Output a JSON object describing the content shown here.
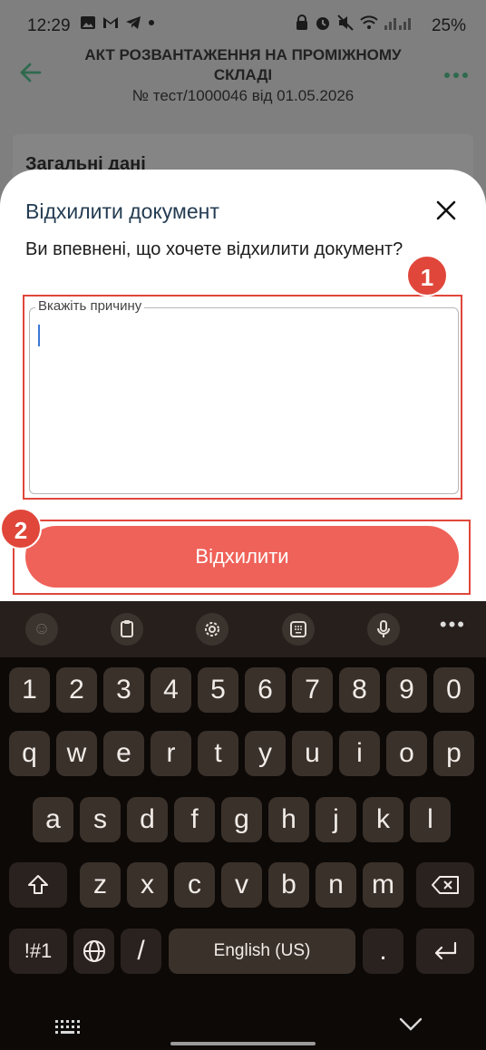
{
  "status_bar": {
    "time": "12:29",
    "battery": "25%",
    "left_icons": [
      "gallery-icon",
      "gmail-icon",
      "telegram-icon",
      "dot-icon"
    ],
    "right_icons": [
      "lock-icon",
      "alarm-icon",
      "mute-icon",
      "wifi-icon",
      "signal-icon"
    ]
  },
  "header": {
    "title_line1": "АКТ РОЗВАНТАЖЕННЯ НА ПРОМІЖНОМУ",
    "title_line2": "СКЛАДІ",
    "subtitle": "№ тест/1000046 від 01.05.2026"
  },
  "background_card": {
    "title": "Загальні дані"
  },
  "dialog": {
    "title": "Відхилити документ",
    "question": "Ви впевнені, що хочете відхилити документ?",
    "reason_label": "Вкажіть причину",
    "reason_value": "",
    "reject_button": "Відхилити",
    "callout_1": "1",
    "callout_2": "2"
  },
  "keyboard": {
    "toolbar": [
      "emoji-icon",
      "clipboard-icon",
      "settings-icon",
      "keypad-icon",
      "microphone-icon",
      "more-icon"
    ],
    "row_numbers": [
      "1",
      "2",
      "3",
      "4",
      "5",
      "6",
      "7",
      "8",
      "9",
      "0"
    ],
    "row_top": [
      "q",
      "w",
      "e",
      "r",
      "t",
      "y",
      "u",
      "i",
      "o",
      "p"
    ],
    "row_middle": [
      "a",
      "s",
      "d",
      "f",
      "g",
      "h",
      "j",
      "k",
      "l"
    ],
    "row_bottom": [
      "z",
      "x",
      "c",
      "v",
      "b",
      "n",
      "m"
    ],
    "symbols_key": "!#1",
    "slash_key": "/",
    "space_key": "English (US)",
    "period_key": ".",
    "shift_icon": "shift-icon",
    "backspace_icon": "backspace-icon",
    "globe_icon": "globe-icon",
    "enter_icon": "enter-icon"
  },
  "colors": {
    "accent_green": "#2f6a4f",
    "reject_button": "#ef6259",
    "annotation_red": "#e0473a",
    "dialog_title": "#243c52"
  }
}
